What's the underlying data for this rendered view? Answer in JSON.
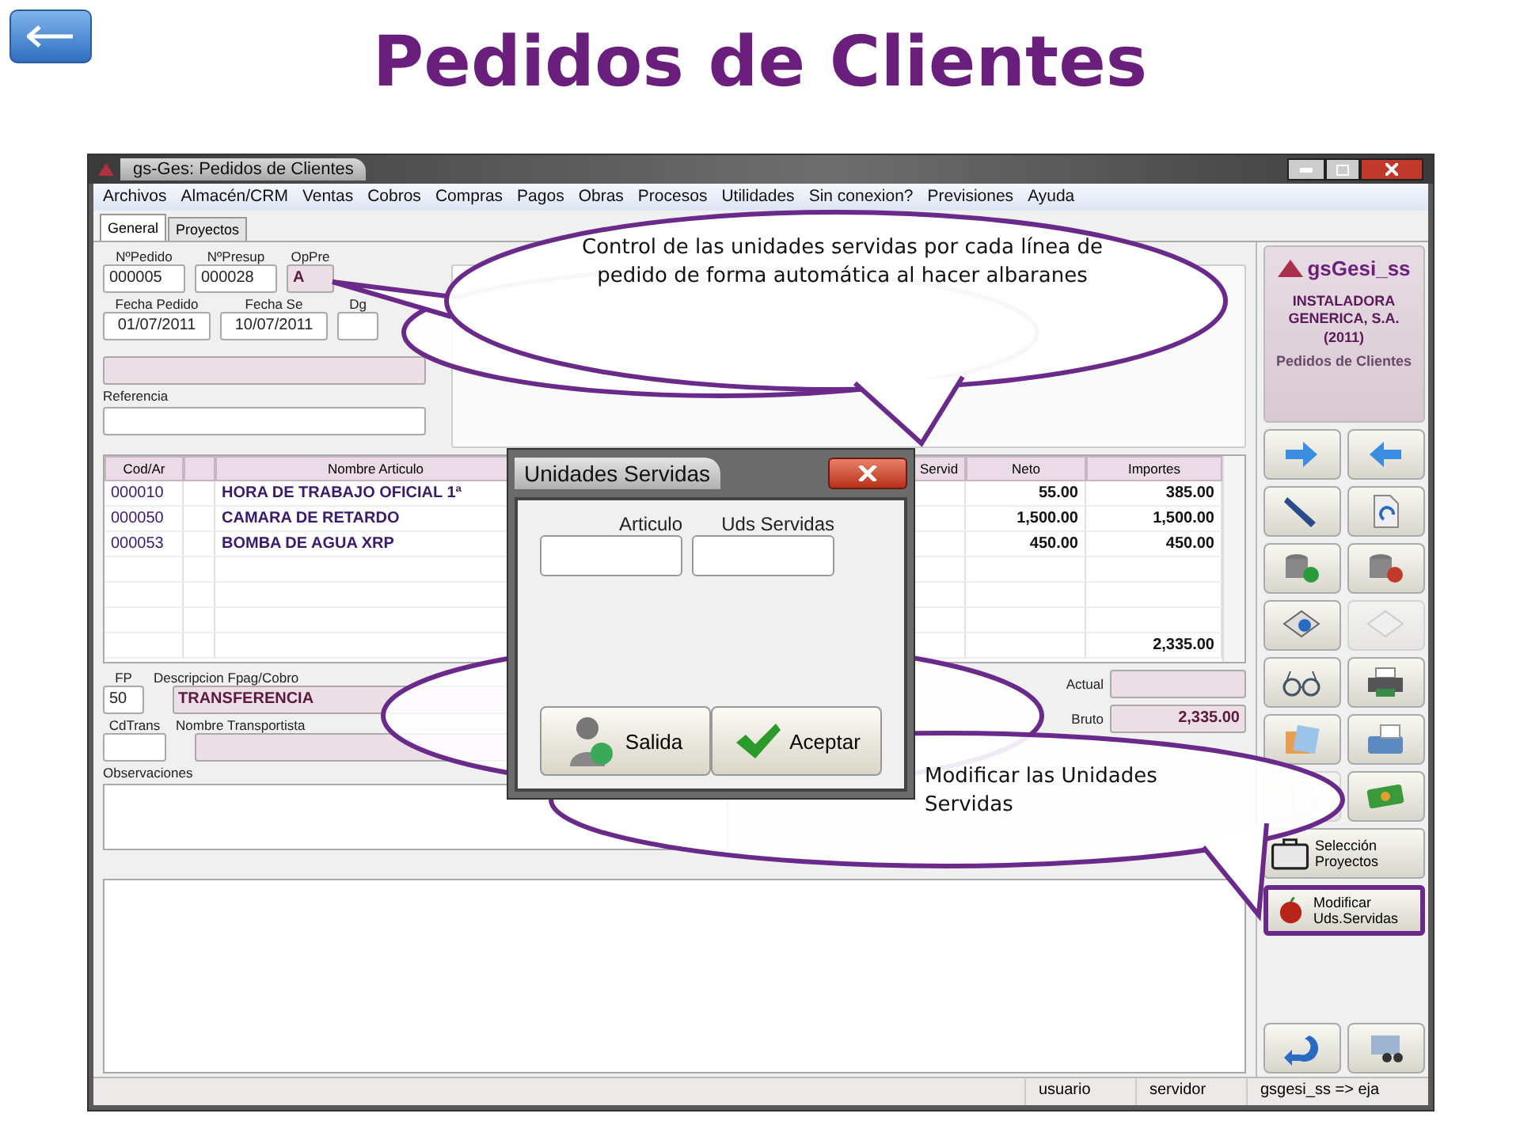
{
  "slide_title": "Pedidos de Clientes",
  "window": {
    "title": "gs-Ges: Pedidos de Clientes"
  },
  "menu": [
    "Archivos",
    "Almacén/CRM",
    "Ventas",
    "Cobros",
    "Compras",
    "Pagos",
    "Obras",
    "Procesos",
    "Utilidades",
    "Sin conexion?",
    "Previsiones",
    "Ayuda"
  ],
  "tabs": [
    {
      "label": "General",
      "selected": true
    },
    {
      "label": "Proyectos",
      "selected": false
    }
  ],
  "header_fields": [
    {
      "label": "NºPedido",
      "value": "000005",
      "kind": "text"
    },
    {
      "label": "NºPresup",
      "value": "000028",
      "kind": "text"
    },
    {
      "label": "OpPre",
      "value": "A",
      "kind": "shaded"
    }
  ],
  "date_fields": [
    {
      "label": "Fecha Pedido",
      "value": "01/07/2011"
    },
    {
      "label": "Fecha Se",
      "value": "10/07/2011"
    },
    {
      "label": "Dg"
    }
  ],
  "reference": {
    "label": "Referencia"
  },
  "table": {
    "columns": [
      "Cod/Ar",
      "",
      "Nombre Articulo",
      "Servid",
      "Neto",
      "Importes"
    ],
    "rows": [
      [
        "000010",
        "",
        "HORA DE TRABAJO OFICIAL 1ª",
        "",
        "55.00",
        "385.00"
      ],
      [
        "000050",
        "",
        "CAMARA DE RETARDO",
        "",
        "1,500.00",
        "1,500.00"
      ],
      [
        "000053",
        "",
        "BOMBA DE AGUA XRP",
        "",
        "450.00",
        "450.00"
      ]
    ],
    "total": "2,335.00"
  },
  "payment": {
    "fp_label": "FP",
    "fp_value": "50",
    "desc_label": "Descripcion Fpag/Cobro",
    "desc_value": "TRANSFERENCIA",
    "trans_label": "CdTrans",
    "carrier_label": "Nombre Transportista",
    "notes_label": "Observaciones"
  },
  "totals": [
    {
      "label": "Actual"
    },
    {
      "label": "Bruto",
      "value": "2,335.00"
    }
  ],
  "company": {
    "logo": "gsGesi_ss",
    "name": "INSTALADORA GENERICA, S.A.",
    "year": "(2011)",
    "module": "Pedidos de Clientes"
  },
  "toolbar": [
    {
      "kind": "icon",
      "disabled": false
    },
    {
      "kind": "icon",
      "disabled": false
    },
    {
      "kind": "icon",
      "disabled": false
    },
    {
      "kind": "icon",
      "disabled": false
    },
    {
      "kind": "icon",
      "disabled": false
    },
    {
      "kind": "icon",
      "disabled": false
    },
    {
      "kind": "icon",
      "disabled": false
    },
    {
      "kind": "icon",
      "disabled": true
    },
    {
      "kind": "icon",
      "disabled": false
    },
    {
      "kind": "icon",
      "disabled": false
    },
    {
      "kind": "icon",
      "disabled": false
    },
    {
      "kind": "icon",
      "disabled": false
    },
    {
      "kind": "icon",
      "disabled": true
    },
    {
      "kind": "icon",
      "disabled": false
    },
    {
      "kind": "wide",
      "label": "Selección Proyectos",
      "selected": false
    },
    {
      "kind": "wide",
      "label": "Modificar Uds.Servidas",
      "selected": true
    }
  ],
  "status_bar": [
    "usuario",
    "servidor",
    "gsgesi_ss => eja"
  ],
  "dialog": {
    "title": "Unidades Servidas",
    "fields": [
      {
        "label": "Articulo"
      },
      {
        "label": "Uds Servidas"
      }
    ],
    "buttons": [
      "Salida",
      "Aceptar"
    ]
  },
  "callouts": [
    {
      "text": "Control de las unidades servidas  por cada línea de pedido de forma automática al hacer albaranes"
    },
    {
      "text": "Modificar las Unidades Servidas"
    }
  ]
}
